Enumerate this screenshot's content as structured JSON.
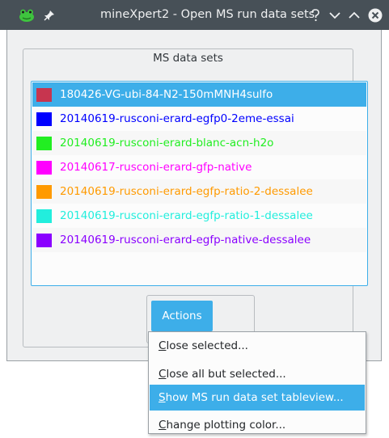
{
  "window": {
    "title": "mineXpert2 - Open MS run data sets",
    "controls": [
      "help",
      "minimize",
      "maximize",
      "close"
    ]
  },
  "group": {
    "title": "MS data sets"
  },
  "data_sets": [
    {
      "name": "180426-VG-ubi-84-N2-150mMNH4sulfo",
      "color": "#c7354f",
      "selected": true
    },
    {
      "name": "20140619-rusconi-erard-egfp0-2eme-essai",
      "color": "#0000ff",
      "selected": false
    },
    {
      "name": "20140619-rusconi-erard-blanc-acn-h2o",
      "color": "#22ee22",
      "selected": false
    },
    {
      "name": "20140617-rusconi-erard-gfp-native",
      "color": "#ff00ff",
      "selected": false
    },
    {
      "name": "20140619-rusconi-erard-egfp-ratio-2-dessalee",
      "color": "#ff9a00",
      "selected": false
    },
    {
      "name": "20140619-rusconi-erard-egfp-ratio-1-dessalee",
      "color": "#22eedd",
      "selected": false
    },
    {
      "name": "20140619-rusconi-erard-egfp-native-dessalee",
      "color": "#8a00ff",
      "selected": false
    }
  ],
  "actions_button": {
    "label": "Actions"
  },
  "actions_menu": [
    {
      "key": "C",
      "rest": "lose selected...",
      "highlighted": false
    },
    {
      "key": "C",
      "rest": "lose all but selected...",
      "highlighted": false
    },
    {
      "key": "S",
      "rest": "how MS run data set tableview...",
      "highlighted": true
    },
    {
      "key": "C",
      "rest": "hange plotting color...",
      "highlighted": false
    }
  ],
  "colors": {
    "accent": "#3daee9",
    "titlebar": "#475057"
  }
}
